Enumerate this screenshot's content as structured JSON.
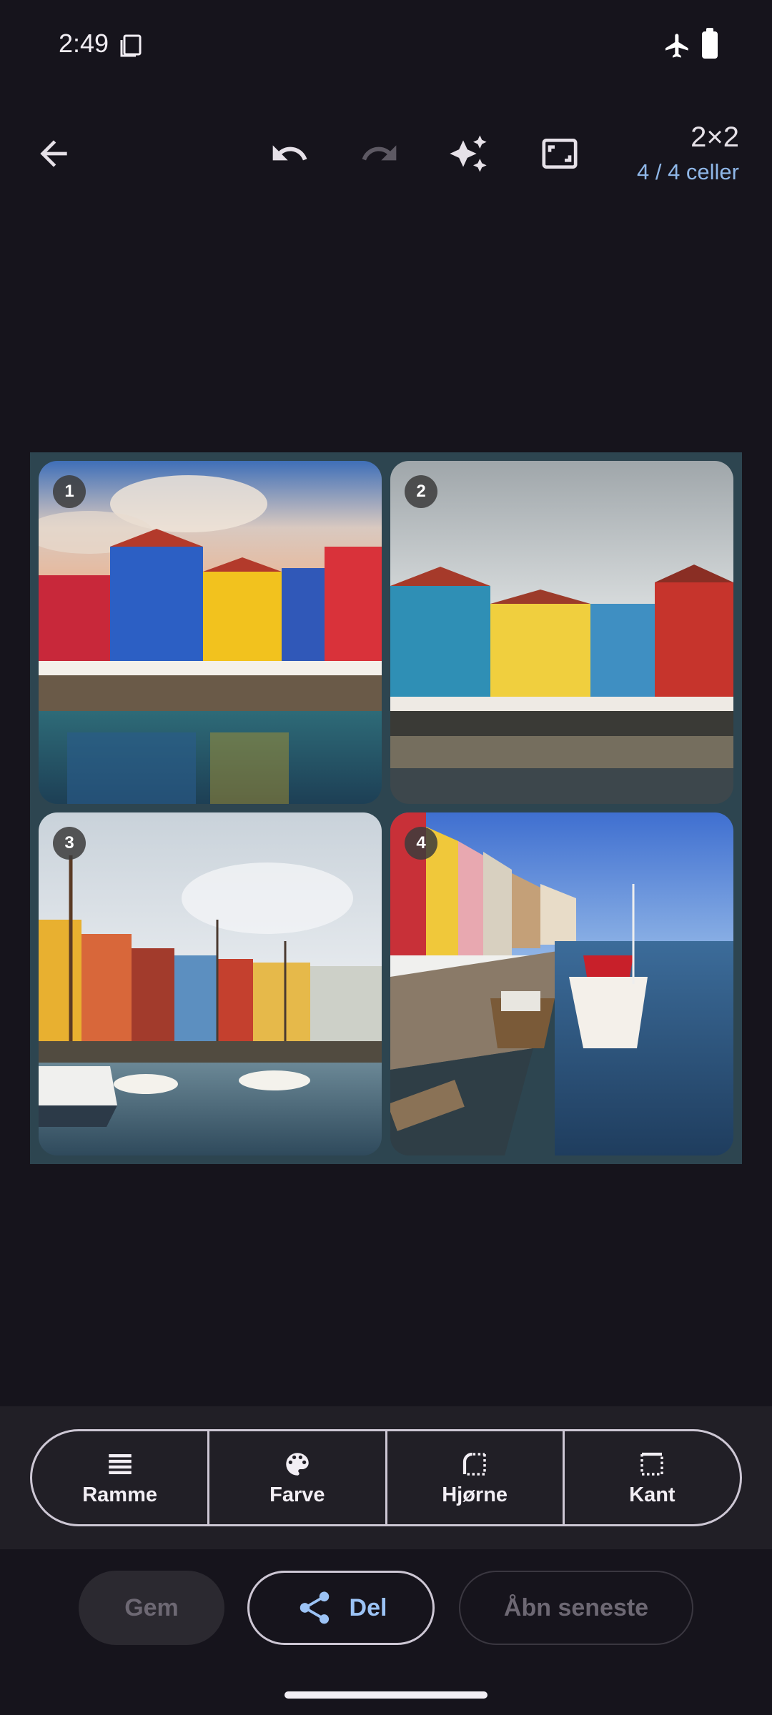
{
  "status_bar": {
    "time": "2:49",
    "icons": [
      "sim-card-icon",
      "airplane-mode-icon",
      "battery-icon"
    ]
  },
  "toolbar": {
    "back_icon": "arrow-back-icon",
    "undo_icon": "undo-icon",
    "redo_icon": "redo-icon",
    "redo_enabled": false,
    "magic_icon": "auto-awesome-icon",
    "frame_icon": "aspect-ratio-icon",
    "grid_size": "2×2",
    "cells_status": "4 / 4 celler"
  },
  "collage": {
    "border_color": "#2d4550",
    "cells": [
      {
        "number": "1"
      },
      {
        "number": "2"
      },
      {
        "number": "3"
      },
      {
        "number": "4"
      }
    ]
  },
  "options": [
    {
      "label": "Ramme",
      "icon": "lines-icon"
    },
    {
      "label": "Farve",
      "icon": "palette-icon"
    },
    {
      "label": "Hjørne",
      "icon": "rounded-corner-icon"
    },
    {
      "label": "Kant",
      "icon": "border-icon"
    }
  ],
  "actions": {
    "save": "Gem",
    "share": "Del",
    "share_icon": "share-icon",
    "open_latest": "Åbn seneste"
  },
  "colors": {
    "background": "#16141c",
    "accent": "#9cc3f5",
    "cells_text": "#8fb7e8"
  }
}
